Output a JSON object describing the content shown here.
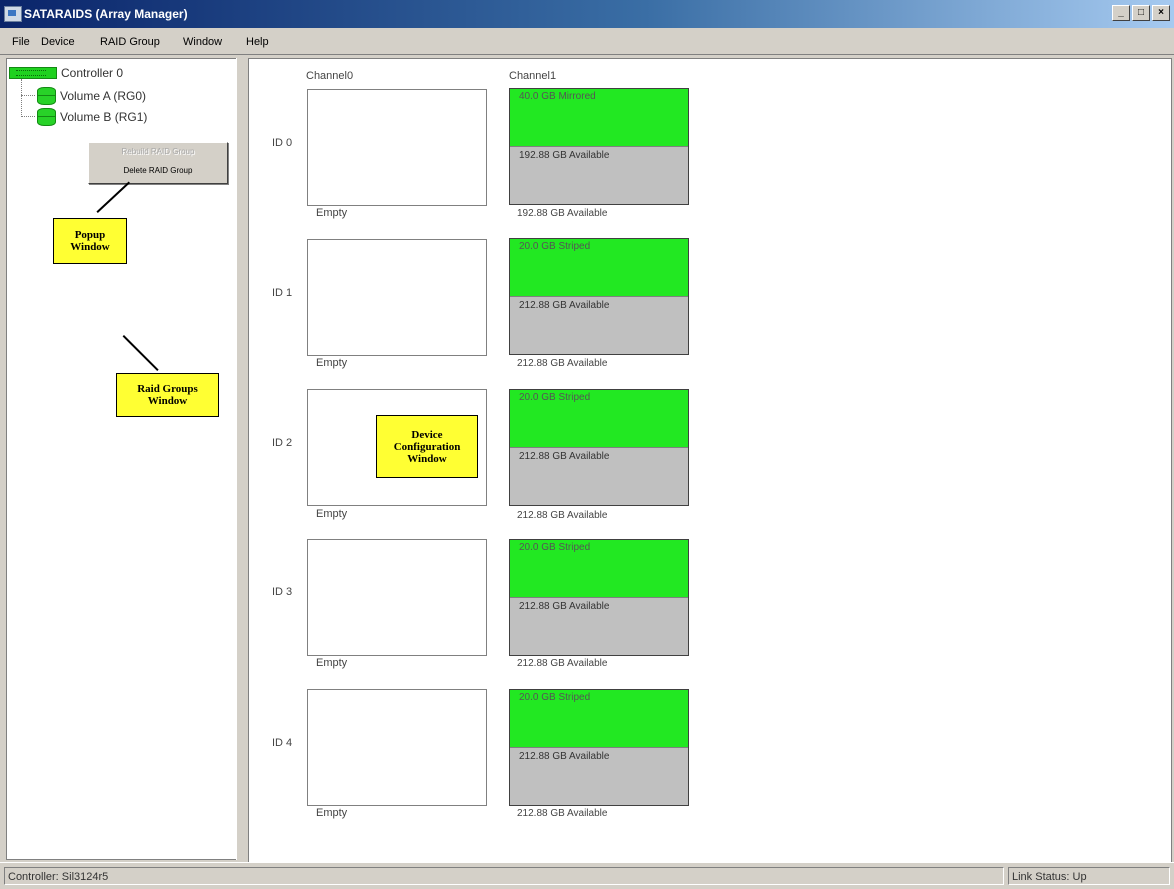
{
  "window": {
    "title": "SATARAIDS (Array Manager)",
    "buttons": {
      "minimize": "_",
      "maximize": "□",
      "close": "×"
    }
  },
  "menu": [
    "File",
    "Device",
    "RAID Group",
    "Window",
    "Help"
  ],
  "tree": {
    "controller": "Controller 0",
    "volumes": [
      "Volume A (RG0)",
      "Volume B (RG1)"
    ]
  },
  "popup_menu": {
    "items": [
      {
        "label": "Rebuild RAID Group",
        "enabled": false
      },
      {
        "label": "Delete RAID Group",
        "enabled": true
      }
    ]
  },
  "callouts": {
    "popup": "Popup Window",
    "raid_groups": "Raid Groups Window",
    "device_config": "Device Configuration Window"
  },
  "device_grid": {
    "columns": [
      "Channel0",
      "Channel1"
    ],
    "rows": [
      {
        "id": "ID 0",
        "channel0": "Empty",
        "used": "40.0 GB Mirrored",
        "free": "192.88 GB Available",
        "label": "192.88 GB Available"
      },
      {
        "id": "ID 1",
        "channel0": "Empty",
        "used": "20.0 GB Striped",
        "free": "212.88 GB Available",
        "label": "212.88 GB Available"
      },
      {
        "id": "ID 2",
        "channel0": "Empty",
        "used": "20.0 GB Striped",
        "free": "212.88 GB Available",
        "label": "212.88 GB Available"
      },
      {
        "id": "ID 3",
        "channel0": "Empty",
        "used": "20.0 GB Striped",
        "free": "212.88 GB Available",
        "label": "212.88 GB Available"
      },
      {
        "id": "ID 4",
        "channel0": "Empty",
        "used": "20.0 GB Striped",
        "free": "212.88 GB Available",
        "label": "212.88 GB Available"
      }
    ]
  },
  "status": {
    "controller": "Controller: Sil3124r5",
    "link": "Link Status: Up"
  },
  "colors": {
    "used_space": "#22e822",
    "free_space": "#c0c0c0",
    "callout": "#ffff33",
    "title_bar": "#0a246a"
  }
}
